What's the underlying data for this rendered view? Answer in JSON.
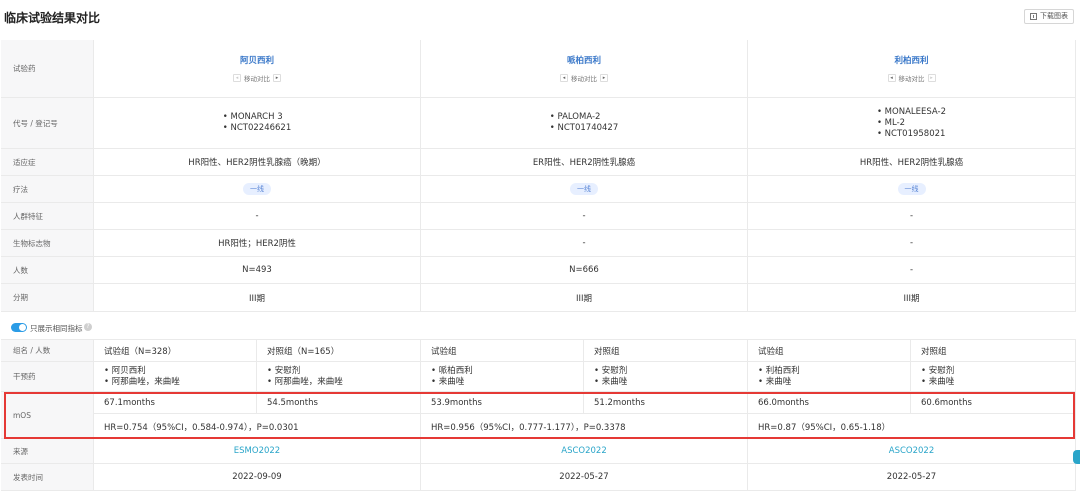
{
  "header": {
    "title": "临床试验结果对比",
    "download_label": "下载图表"
  },
  "labels": {
    "drug": "试验药",
    "code": "代号 / 登记号",
    "indication": "适应症",
    "therapy": "疗法",
    "population": "人群特征",
    "biomarker": "生物标志物",
    "count": "人数",
    "stage": "分期",
    "group": "组名 / 人数",
    "intervention": "干预药",
    "mos": "mOS",
    "source": "来源",
    "date": "发表时间"
  },
  "nav": {
    "prev": "◂",
    "next": "▸",
    "label": "移动对比"
  },
  "toggle": {
    "label": "只展示相同指标",
    "info": "?"
  },
  "trials": [
    {
      "drug": "阿贝西利",
      "codes": [
        "• MONARCH 3",
        "• NCT02246621"
      ],
      "indication": "HR阳性、HER2阴性乳腺癌（晚期）",
      "therapy": "一线",
      "population": "-",
      "biomarker": "HR阳性；HER2阴性",
      "count": "N=493",
      "stage": "III期",
      "groups": [
        "试验组（N=328）",
        "对照组（N=165）"
      ],
      "interventions": [
        [
          "• 阿贝西利",
          "• 阿那曲唑，来曲唑"
        ],
        [
          "• 安慰剂",
          "• 阿那曲唑，来曲唑"
        ]
      ],
      "mos": [
        "67.1months",
        "54.5months"
      ],
      "hr": "HR=0.754（95%CI，0.584-0.974），P=0.0301",
      "source": "ESMO2022",
      "date": "2022-09-09"
    },
    {
      "drug": "哌柏西利",
      "codes": [
        "• PALOMA-2",
        "• NCT01740427"
      ],
      "indication": "ER阳性、HER2阴性乳腺癌",
      "therapy": "一线",
      "population": "-",
      "biomarker": "-",
      "count": "N=666",
      "stage": "III期",
      "groups": [
        "试验组",
        "对照组"
      ],
      "interventions": [
        [
          "• 哌柏西利",
          "• 来曲唑"
        ],
        [
          "• 安慰剂",
          "• 来曲唑"
        ]
      ],
      "mos": [
        "53.9months",
        "51.2months"
      ],
      "hr": "HR=0.956（95%CI，0.777-1.177），P=0.3378",
      "source": "ASCO2022",
      "date": "2022-05-27"
    },
    {
      "drug": "利柏西利",
      "codes": [
        "• MONALEESA-2",
        "• ML-2",
        "• NCT01958021"
      ],
      "indication": "HR阳性、HER2阴性乳腺癌",
      "therapy": "一线",
      "population": "-",
      "biomarker": "-",
      "count": "-",
      "stage": "III期",
      "groups": [
        "试验组",
        "对照组"
      ],
      "interventions": [
        [
          "• 利柏西利",
          "• 来曲唑"
        ],
        [
          "• 安慰剂",
          "• 来曲唑"
        ]
      ],
      "mos": [
        "66.0months",
        "60.6months"
      ],
      "hr": "HR=0.87（95%CI，0.65-1.18）",
      "source": "ASCO2022",
      "date": "2022-05-27"
    }
  ],
  "colors": {
    "accent": "#2aa5c9",
    "drug": "#3a78c9",
    "highlight": "#e53935"
  }
}
